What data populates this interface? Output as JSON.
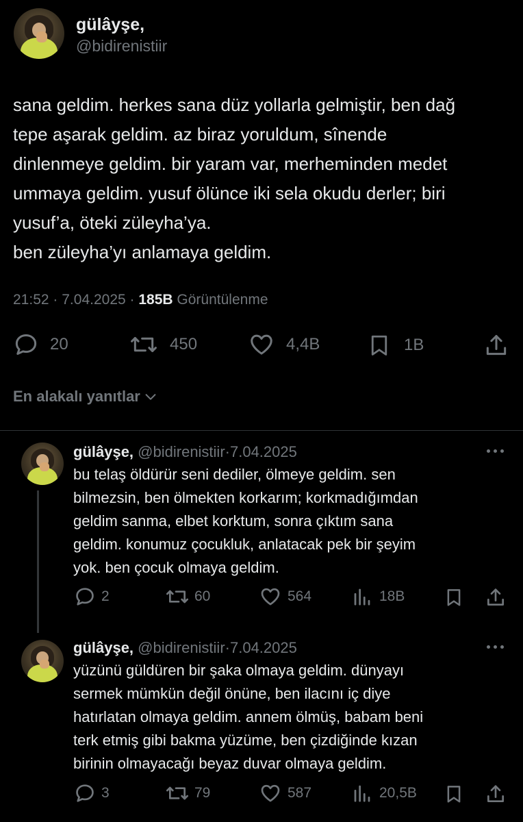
{
  "main_tweet": {
    "display_name": "gülâyşe,",
    "handle": "@bidirenistiir",
    "text": "sana geldim. herkes sana düz yollarla gelmiştir, ben dağ\ntepe aşarak geldim. az biraz yoruldum, sînende\ndinlenmeye geldim. bir yaram var, merheminden medet\nummaya geldim. yusuf ölünce iki sela okudu derler; biri\nyusuf’a, öteki züleyha’ya.\nben züleyha’yı anlamaya geldim.",
    "time": "21:52",
    "separator": "·",
    "date": "7.04.2025",
    "views_count": "185B",
    "views_label": "Görüntülenme",
    "actions": {
      "replies": "20",
      "reposts": "450",
      "likes": "4,4B",
      "bookmarks": "1B"
    }
  },
  "replies_sort": {
    "label": "En alakalı yanıtlar"
  },
  "replies": [
    {
      "display_name": "gülâyşe,",
      "handle": "@bidirenistiir",
      "separator": "·",
      "date": "7.04.2025",
      "text": "bu telaş öldürür seni dediler, ölmeye geldim. sen\nbilmezsin, ben ölmekten korkarım; korkmadığımdan\ngeldim sanma, elbet korktum, sonra çıktım sana\ngeldim. konumuz çocukluk, anlatacak pek bir şeyim\nyok. ben çocuk olmaya geldim.",
      "actions": {
        "replies": "2",
        "reposts": "60",
        "likes": "564",
        "views": "18B"
      }
    },
    {
      "display_name": "gülâyşe,",
      "handle": "@bidirenistiir",
      "separator": "·",
      "date": "7.04.2025",
      "text": "yüzünü güldüren bir şaka olmaya geldim. dünyayı\nsermek mümkün değil önüne, ben ilacını iç diye\nhatırlatan olmaya geldim. annem ölmüş, babam beni\nterk etmiş gibi bakma yüzüme, ben çizdiğinde kızan\nbirinin olmayacağı beyaz duvar olmaya geldim.",
      "actions": {
        "replies": "3",
        "reposts": "79",
        "likes": "587",
        "views": "20,5B"
      }
    }
  ],
  "icons": {
    "reply": "reply-icon",
    "repost": "repost-icon",
    "like": "heart-icon",
    "bookmark": "bookmark-icon",
    "share": "share-icon",
    "views": "views-icon",
    "more": "more-icon",
    "sort": "chevron-down-icon"
  },
  "colors": {
    "background": "#000000",
    "primary_text": "#e7e9ea",
    "secondary_text": "#71767b",
    "divider": "#2f3336"
  }
}
